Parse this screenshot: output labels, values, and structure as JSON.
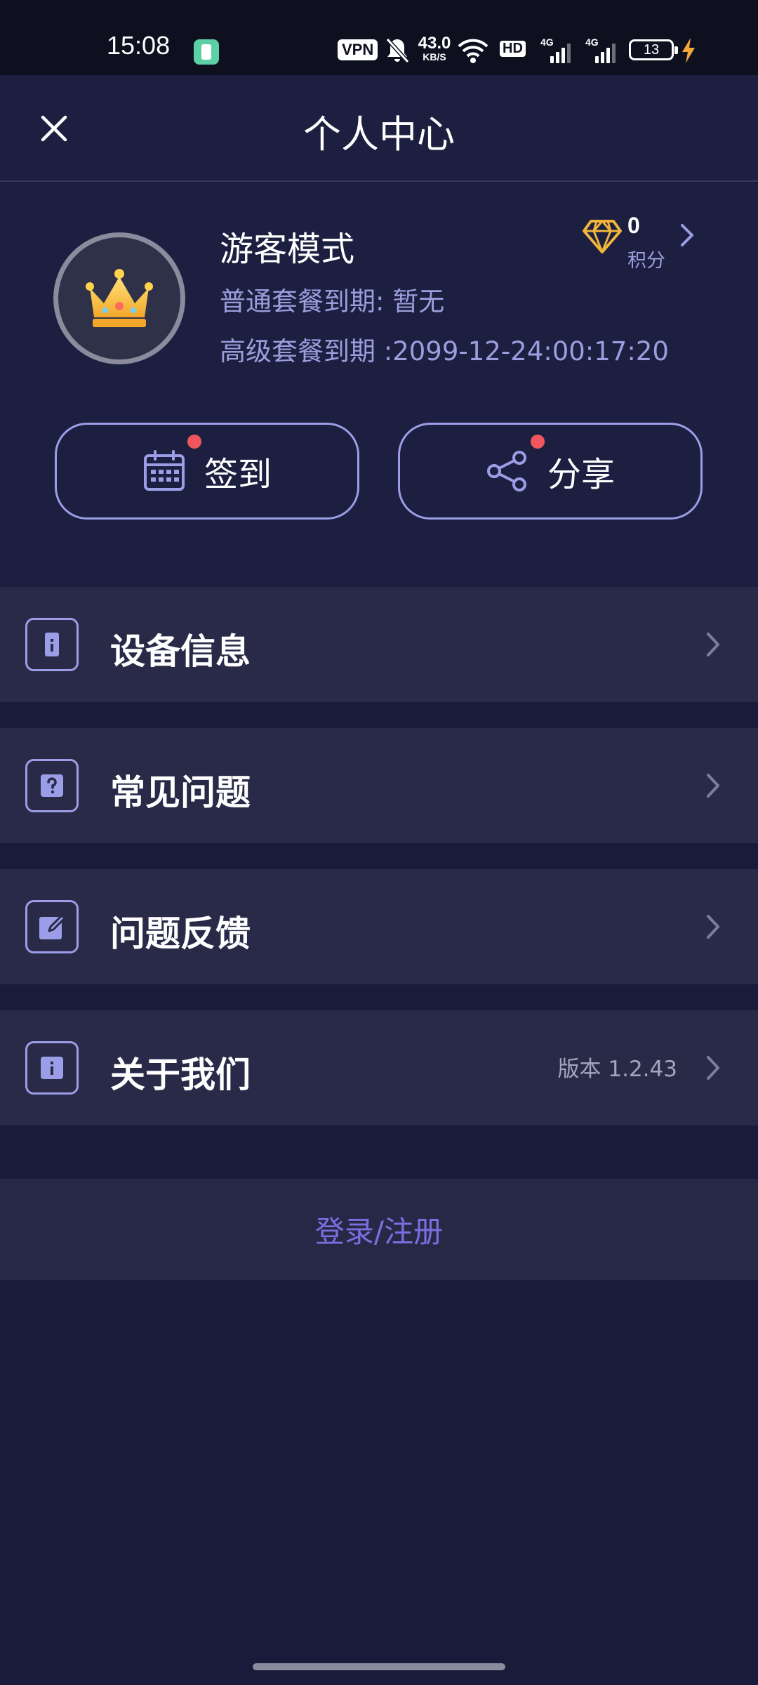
{
  "status_bar": {
    "time": "15:08",
    "vpn": "VPN",
    "net_speed_value": "43.0",
    "net_speed_unit": "KB/S",
    "hd": "HD",
    "signal1": "4G",
    "signal2": "4G",
    "battery": "13"
  },
  "header": {
    "title": "个人中心",
    "close_icon": "close-icon"
  },
  "profile": {
    "name": "游客模式",
    "normal_plan": "普通套餐到期:  暂无",
    "premium_plan": "高级套餐到期 :2099-12-24:00:17:20",
    "points_value": "0",
    "points_label": "积分",
    "avatar_icon": "crown-icon",
    "points_icon": "diamond-icon"
  },
  "actions": {
    "sign_in": "签到",
    "share": "分享"
  },
  "menu": [
    {
      "label": "设备信息",
      "icon": "device-icon"
    },
    {
      "label": "常见问题",
      "icon": "question-icon"
    },
    {
      "label": "问题反馈",
      "icon": "edit-icon"
    },
    {
      "label": "关于我们",
      "icon": "info-icon",
      "extra": "版本  1.2.43"
    }
  ],
  "login": "登录/注册",
  "colors": {
    "background": "#191b3a",
    "card": "#282a48",
    "accent": "#9b9ee6",
    "login_text": "#7b6fe0",
    "badge": "#f0575c",
    "diamond": "#f2b53c"
  }
}
